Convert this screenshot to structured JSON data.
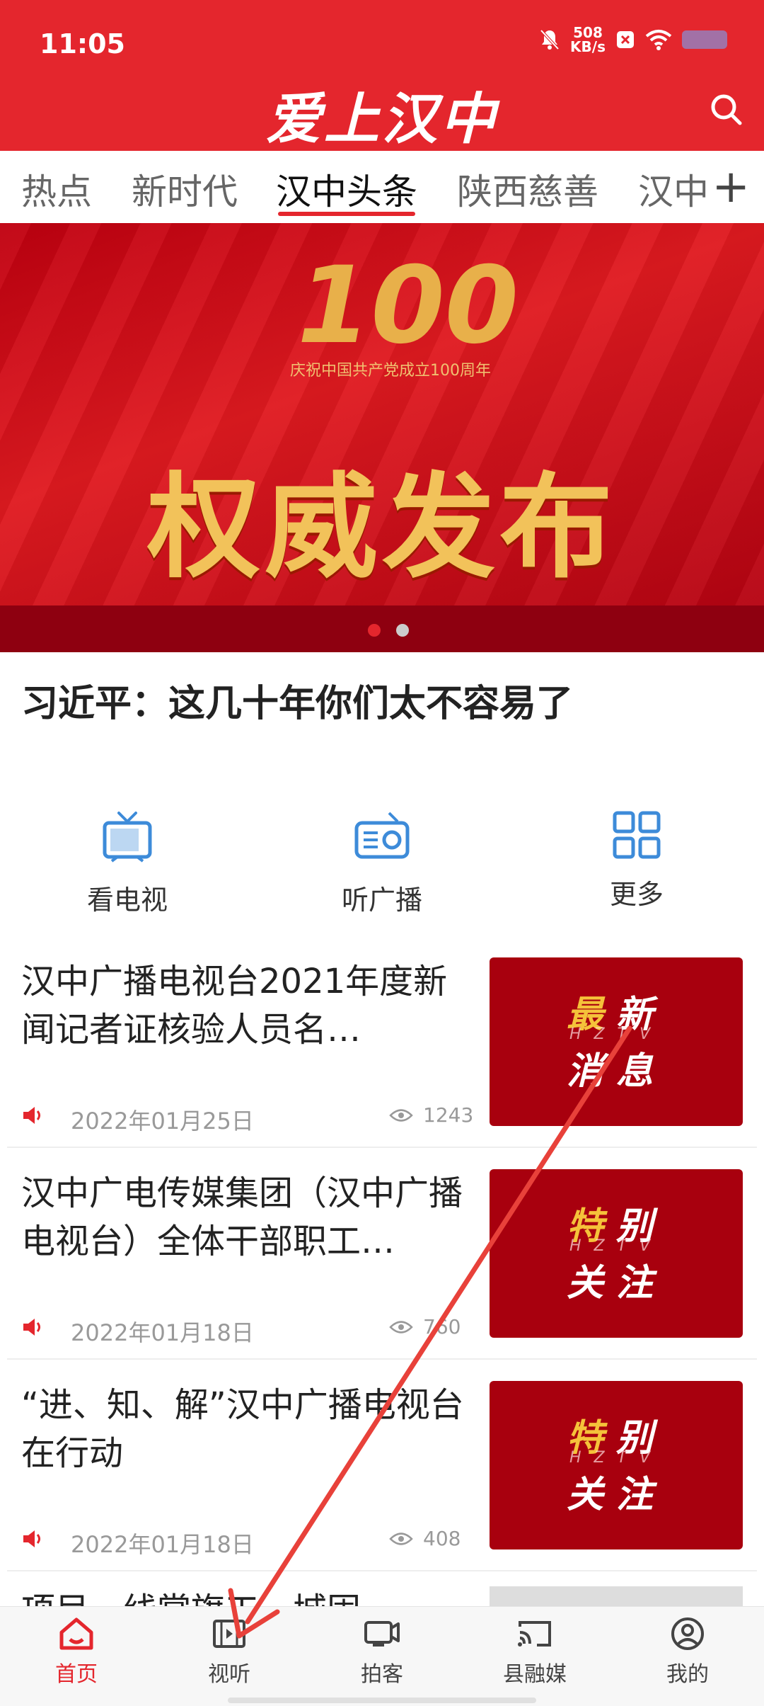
{
  "status_bar": {
    "time": "11:05",
    "net_speed": "508",
    "net_unit": "KB/s"
  },
  "header": {
    "logo": "爱上汉中"
  },
  "tabs": [
    "热点",
    "新时代",
    "汉中头条",
    "陕西慈善",
    "汉中"
  ],
  "banner": {
    "number": "100",
    "subtitle": "庆祝中国共产党成立100周年",
    "title": "权威发布",
    "headline": "习近平：这几十年你们太不容易了"
  },
  "quick_menu": [
    {
      "label": "看电视",
      "icon": "tv-icon"
    },
    {
      "label": "听广播",
      "icon": "radio-icon"
    },
    {
      "label": "更多",
      "icon": "grid-icon"
    }
  ],
  "news": [
    {
      "title": "汉中广播电视台2021年度新闻记者证核验人员名…",
      "date": "2022年01月25日",
      "views": "1243",
      "thumb_l1a": "最",
      "thumb_l1b": "新",
      "thumb_l2": "消息"
    },
    {
      "title": "汉中广电传媒集团（汉中广播电视台）全体干部职工…",
      "date": "2022年01月18日",
      "views": "760",
      "thumb_l1a": "特",
      "thumb_l1b": "别",
      "thumb_l2": "关注"
    },
    {
      "title": "“进、知、解”汉中广播电视台在行动",
      "date": "2022年01月18日",
      "views": "408",
      "thumb_l1a": "特",
      "thumb_l1b": "别",
      "thumb_l2": "关注"
    }
  ],
  "news_partial": "项目一线掌旗工…城固",
  "thumb_mark": "HZTV",
  "bottom_nav": [
    {
      "label": "首页",
      "icon": "home-icon"
    },
    {
      "label": "视听",
      "icon": "film-icon"
    },
    {
      "label": "拍客",
      "icon": "camera-icon"
    },
    {
      "label": "县融媒",
      "icon": "cast-icon"
    },
    {
      "label": "我的",
      "icon": "user-icon"
    }
  ],
  "colors": {
    "brand": "#e4262d",
    "accent_blue": "#3d8bd9",
    "thumb_red": "#a8000e"
  }
}
